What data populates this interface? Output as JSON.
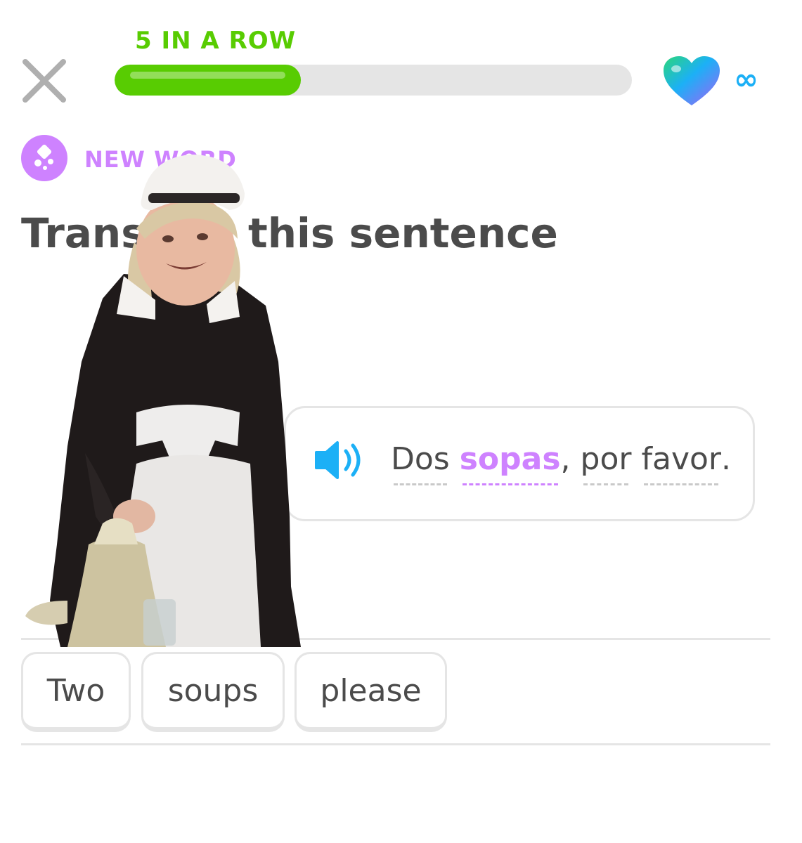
{
  "header": {
    "streak_label": "5 IN A ROW",
    "progress": 0.36,
    "lives": "∞",
    "icons": {
      "close": "close-icon",
      "heart": "heart-icon"
    }
  },
  "lesson": {
    "badge": "NEW WORD",
    "badge_icon": "new-word-icon",
    "title": "Translate this sentence",
    "sentence": {
      "words": [
        "Dos",
        "sopas",
        "por",
        "favor"
      ],
      "highlighted_word": "sopas",
      "comma": ",",
      "period": "."
    },
    "speaker_icon": "speaker-icon"
  },
  "answer": {
    "chips": [
      "Two",
      "soups",
      "please"
    ]
  },
  "overlay": {
    "description_icon": "maid-cutout-image"
  },
  "colors": {
    "green": "#58cc02",
    "purple": "#ce82ff",
    "blue": "#1cb0f6",
    "gray_text": "#4b4b4b",
    "border": "#e5e5e5"
  }
}
